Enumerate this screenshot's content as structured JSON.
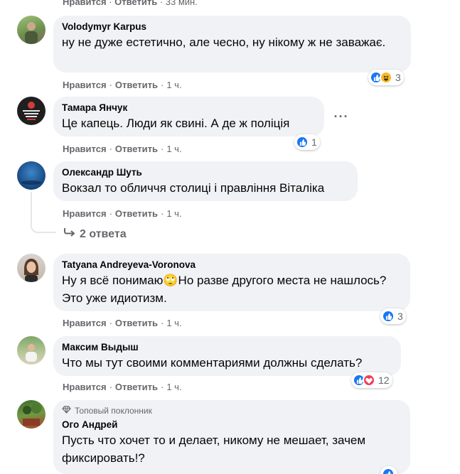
{
  "top_actions": {
    "like": "Нравится",
    "reply": "Ответить",
    "time": "33 мин."
  },
  "comments": [
    {
      "author": "Volodymyr Karpus",
      "text": "ну не дуже естетично, але чесно, ну нікому ж не заважає.",
      "like": "Нравится",
      "reply": "Ответить",
      "time": "1 ч.",
      "reaction_count": "3",
      "reactions": [
        "like",
        "haha"
      ]
    },
    {
      "author": "Тамара Янчук",
      "text": "Це капець. Люди як свині. А де ж поліція",
      "like": "Нравится",
      "reply": "Ответить",
      "time": "1 ч.",
      "reaction_count": "1",
      "reactions": [
        "like"
      ]
    },
    {
      "author": "Олександр Шуть",
      "text": "Вокзал то обличчя столиці і правління Віталіка",
      "like": "Нравится",
      "reply": "Ответить",
      "time": "1 ч.",
      "replies_label": "2 ответа"
    },
    {
      "author": "Tatyana Andreyeva-Voronova",
      "text": "Ну я всё понимаю🙄Но разве другого места не нашлось? Это уже идиотизм.",
      "like": "Нравится",
      "reply": "Ответить",
      "time": "1 ч.",
      "reaction_count": "3",
      "reactions": [
        "like"
      ]
    },
    {
      "author": "Максим Выдыш",
      "text": "Что мы тут своими комментариями должны сделать?",
      "like": "Нравится",
      "reply": "Ответить",
      "time": "1 ч.",
      "reaction_count": "12",
      "reactions": [
        "like",
        "love"
      ]
    },
    {
      "badge": "Топовый поклонник",
      "author": "Ого Андрей",
      "text": "Пусть что хочет то и делает, никому не мешает, зачем фиксировать!?"
    }
  ],
  "colors": {
    "like": "#1877f2",
    "love": "#f33e58",
    "haha": "#f7b928",
    "bubble": "#f0f2f5",
    "meta": "#65676b"
  }
}
